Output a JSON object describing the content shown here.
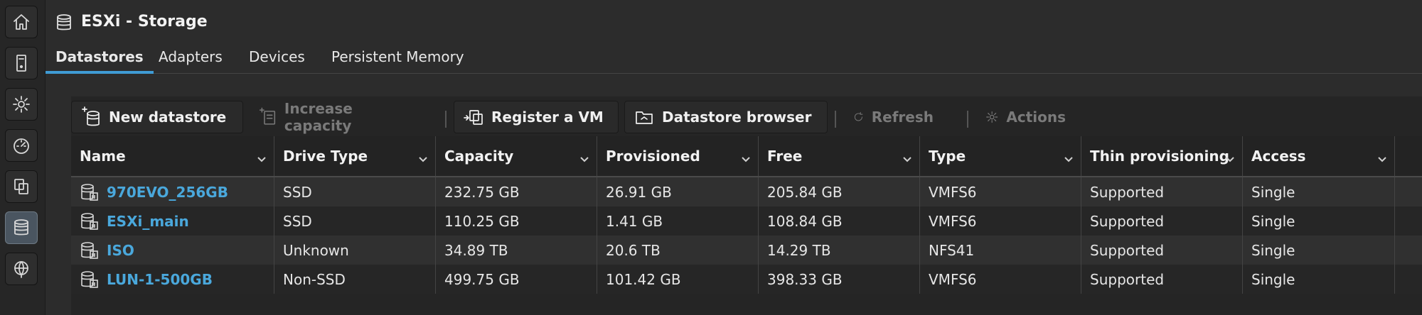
{
  "rail": {
    "items": [
      {
        "icon": "home-icon"
      },
      {
        "icon": "host-icon"
      },
      {
        "icon": "settings-icon"
      },
      {
        "icon": "monitor-icon"
      },
      {
        "icon": "virtual-machines-icon"
      },
      {
        "icon": "storage-icon",
        "active": true
      },
      {
        "icon": "networking-icon"
      }
    ]
  },
  "header": {
    "title": "ESXi - Storage",
    "icon": "storage-icon"
  },
  "tabs": [
    {
      "label": "Datastores",
      "active": true
    },
    {
      "label": "Adapters"
    },
    {
      "label": "Devices"
    },
    {
      "label": "Persistent Memory"
    }
  ],
  "toolbar": {
    "new_datastore": "New datastore",
    "increase_capacity": "Increase capacity",
    "register_vm": "Register a VM",
    "datastore_browser": "Datastore browser",
    "refresh": "Refresh",
    "actions": "Actions"
  },
  "table": {
    "columns": [
      "Name",
      "Drive Type",
      "Capacity",
      "Provisioned",
      "Free",
      "Type",
      "Thin provisioning",
      "Access"
    ],
    "rows": [
      {
        "name": "970EVO_256GB",
        "drive_type": "SSD",
        "capacity": "232.75 GB",
        "provisioned": "26.91 GB",
        "free": "205.84 GB",
        "type": "VMFS6",
        "thin": "Supported",
        "access": "Single"
      },
      {
        "name": "ESXi_main",
        "drive_type": "SSD",
        "capacity": "110.25 GB",
        "provisioned": "1.41 GB",
        "free": "108.84 GB",
        "type": "VMFS6",
        "thin": "Supported",
        "access": "Single"
      },
      {
        "name": "ISO",
        "drive_type": "Unknown",
        "capacity": "34.89 TB",
        "provisioned": "20.6 TB",
        "free": "14.29 TB",
        "type": "NFS41",
        "thin": "Supported",
        "access": "Single"
      },
      {
        "name": "LUN-1-500GB",
        "drive_type": "Non-SSD",
        "capacity": "499.75 GB",
        "provisioned": "101.42 GB",
        "free": "398.33 GB",
        "type": "VMFS6",
        "thin": "Supported",
        "access": "Single"
      }
    ]
  },
  "colors": {
    "accent": "#3f9bd5",
    "link": "#4aa8dc",
    "background": "#2c2c2c"
  }
}
